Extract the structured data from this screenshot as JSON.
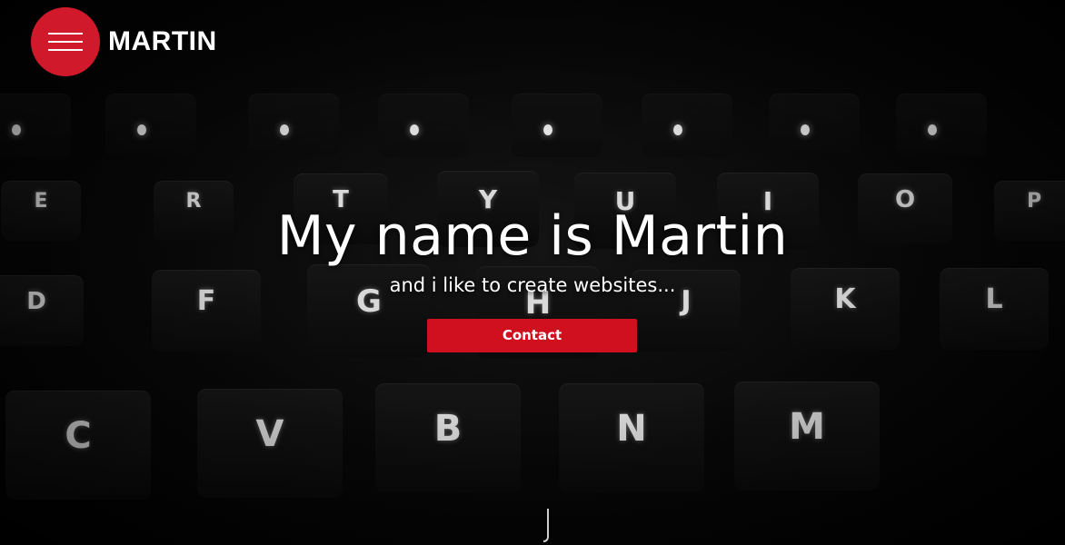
{
  "header": {
    "brand": "MARTIN",
    "menu_icon": "hamburger-icon",
    "accent_color": "#d0192b"
  },
  "hero": {
    "headline": "My name is Martin",
    "subline": "and i like to create websites...",
    "contact_label": "Contact",
    "button_color": "#d0101f",
    "background": "dark keyboard photo",
    "scroll_icon": "scroll-down-icon"
  },
  "keyboard_keys": [
    "E",
    "R",
    "T",
    "Y",
    "U",
    "I",
    "O",
    "P",
    "D",
    "F",
    "G",
    "H",
    "J",
    "K",
    "L",
    "C",
    "V",
    "B",
    "N",
    "M"
  ]
}
